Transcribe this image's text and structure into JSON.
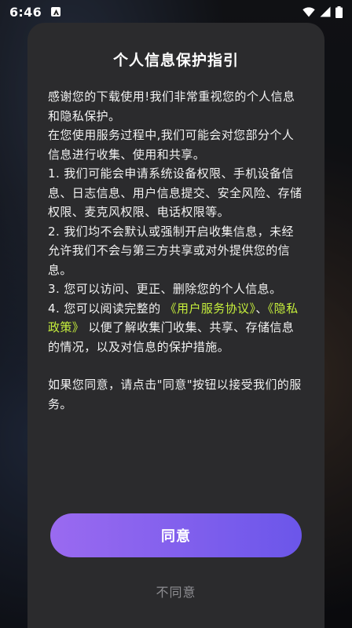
{
  "status_bar": {
    "time": "6:46",
    "notification_icon": "app-notification-icon",
    "wifi_icon": "wifi-icon",
    "signal_icon": "cell-signal-icon",
    "battery_icon": "battery-icon"
  },
  "dialog": {
    "title": "个人信息保护指引",
    "paragraphs": {
      "p1": "感谢您的下载使用!我们非常重视您的个人信息和隐私保护。",
      "p2": "在您使用服务过程中,我们可能会对您部分个人信息进行收集、使用和共享。",
      "p3": "1. 我们可能会申请系统设备权限、手机设备信息、日志信息、用户信息提交、安全风险、存储权限、麦克风权限、电话权限等。",
      "p4": "2. 我们均不会默认或强制开启收集信息，未经允许我们不会与第三方共享或对外提供您的信息。",
      "p5": "3. 您可以访问、更正、删除您的个人信息。",
      "p6_prefix": "4. 您可以阅读完整的 ",
      "user_agreement_link": "《用户服务协议》",
      "p6_sep": "、",
      "privacy_policy_link": "《隐私政策》",
      "p6_suffix": " 以便了解收集门收集、共享、存储信息的情况，以及对信息的保护措施。",
      "p7": "如果您同意，请点击\"同意\"按钮以接受我们的服务。"
    },
    "agree_label": "同意",
    "decline_label": "不同意",
    "link_color": "#c6ef3c",
    "button_gradient": [
      "#9a6af0",
      "#6b56ea"
    ]
  }
}
